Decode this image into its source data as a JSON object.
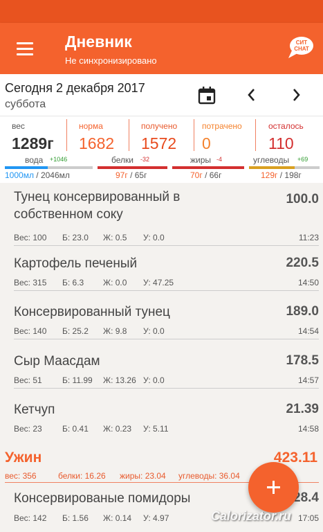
{
  "header": {
    "title": "Дневник",
    "subtitle": "Не синхронизировано",
    "chat_logo_text_1": "СИТ",
    "chat_logo_text_2": "CHAT"
  },
  "date": {
    "main": "Сегодня 2 декабря 2017",
    "weekday": "суббота"
  },
  "stats": {
    "weight": {
      "label": "вес",
      "value": "1289г"
    },
    "norm": {
      "label": "норма",
      "value": "1682"
    },
    "received": {
      "label": "получено",
      "value": "1572"
    },
    "spent": {
      "label": "потрачено",
      "value": "0"
    },
    "left": {
      "label": "осталось",
      "value": "110"
    }
  },
  "macros": {
    "water": {
      "label": "вода",
      "delta": "+1046",
      "value_main": "1000мл",
      "value_rest": " / 2046мл",
      "fill_fraction": 0.49
    },
    "protein": {
      "label": "белки",
      "delta": "-32",
      "value_main": "97г",
      "value_rest": " / 65г",
      "fill_fraction": 1.0
    },
    "fat": {
      "label": "жиры",
      "delta": "-4",
      "value_main": "70г",
      "value_rest": " / 66г",
      "fill_fraction": 1.0
    },
    "carbs": {
      "label": "углеводы",
      "delta": "+69",
      "value_main": "129г",
      "value_rest": " / 198г",
      "fill_fraction": 0.65
    }
  },
  "foods": [
    {
      "name": "Тунец консервированный в собственном соку",
      "calories": "100.0",
      "weight": "Вес: 100",
      "protein": "Б: 23.0",
      "fat": "Ж: 0.5",
      "carbs": "У: 0.0",
      "time": "11:23"
    },
    {
      "name": "Картофель печеный",
      "calories": "220.5",
      "weight": "Вес: 315",
      "protein": "Б: 6.3",
      "fat": "Ж: 0.0",
      "carbs": "У: 47.25",
      "time": "14:50"
    },
    {
      "name": "Консервированный тунец",
      "calories": "189.0",
      "weight": "Вес: 140",
      "protein": "Б: 25.2",
      "fat": "Ж: 9.8",
      "carbs": "У: 0.0",
      "time": "14:54"
    },
    {
      "name": "Сыр Маасдам",
      "calories": "178.5",
      "weight": "Вес: 51",
      "protein": "Б: 11.99",
      "fat": "Ж: 13.26",
      "carbs": "У: 0.0",
      "time": "14:57"
    },
    {
      "name": "Кетчуп",
      "calories": "21.39",
      "weight": "Вес: 23",
      "protein": "Б: 0.41",
      "fat": "Ж: 0.23",
      "carbs": "У: 5.11",
      "time": "14:58"
    }
  ],
  "meal": {
    "title": "Ужин",
    "calories": "423.11",
    "weight": "вес: 356",
    "protein": "белки: 16.26",
    "fat": "жиры: 23.04",
    "carbs": "углеводы: 36.04"
  },
  "meal_foods": [
    {
      "name": "Консервированые помидоры",
      "calories": "28.4",
      "weight": "Вес: 142",
      "protein": "Б: 1.56",
      "fat": "Ж: 0.14",
      "carbs": "У: 4.97",
      "time": "17:05"
    }
  ],
  "fab_label": "+",
  "watermark": "Calorizator.ru",
  "colors": {
    "accent": "#f4622d",
    "status_bar": "#e8531f",
    "water": "#2196f3",
    "macro_bar": "#d32f2f",
    "positive": "#2e9b2e",
    "negative": "#d32f2f"
  }
}
